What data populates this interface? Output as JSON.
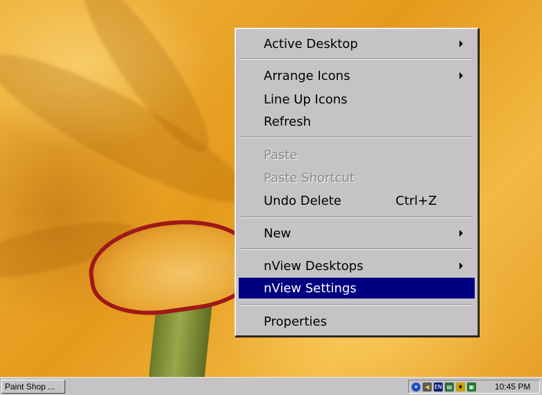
{
  "context_menu": {
    "items": [
      {
        "label": "Active Desktop",
        "shortcut": "",
        "has_submenu": true,
        "disabled": false,
        "highlighted": false
      },
      {
        "label": "Arrange Icons",
        "shortcut": "",
        "has_submenu": true,
        "disabled": false,
        "highlighted": false
      },
      {
        "label": "Line Up Icons",
        "shortcut": "",
        "has_submenu": false,
        "disabled": false,
        "highlighted": false
      },
      {
        "label": "Refresh",
        "shortcut": "",
        "has_submenu": false,
        "disabled": false,
        "highlighted": false
      },
      {
        "label": "Paste",
        "shortcut": "",
        "has_submenu": false,
        "disabled": true,
        "highlighted": false
      },
      {
        "label": "Paste Shortcut",
        "shortcut": "",
        "has_submenu": false,
        "disabled": true,
        "highlighted": false
      },
      {
        "label": "Undo Delete",
        "shortcut": "Ctrl+Z",
        "has_submenu": false,
        "disabled": false,
        "highlighted": false
      },
      {
        "label": "New",
        "shortcut": "",
        "has_submenu": true,
        "disabled": false,
        "highlighted": false
      },
      {
        "label": "nView Desktops",
        "shortcut": "",
        "has_submenu": true,
        "disabled": false,
        "highlighted": false
      },
      {
        "label": "nView Settings",
        "shortcut": "",
        "has_submenu": false,
        "disabled": false,
        "highlighted": true
      },
      {
        "label": "Properties",
        "shortcut": "",
        "has_submenu": false,
        "disabled": false,
        "highlighted": false
      }
    ]
  },
  "taskbar": {
    "task_button_label": "Paint Shop ...",
    "clock": "10:45 PM",
    "tray_icons": [
      "network-icon",
      "sound-icon",
      "language-en-icon",
      "display-icon",
      "security-icon",
      "monitor-icon"
    ],
    "tray_language_label": "EN"
  },
  "colors": {
    "menu_background": "#c6c3c6",
    "highlight": "#000080",
    "wallpaper": "#e9a11f"
  }
}
